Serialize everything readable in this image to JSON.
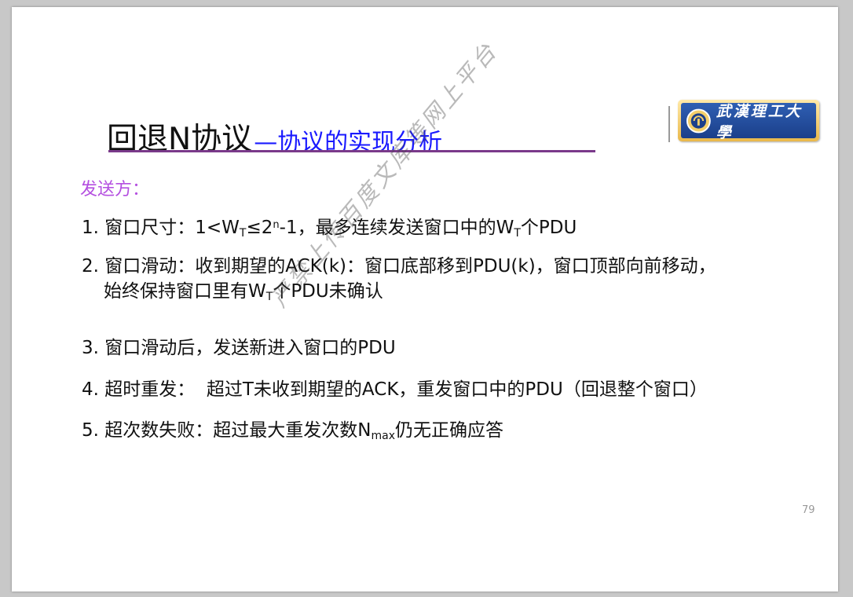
{
  "slide": {
    "title_main": "回退N协议",
    "title_sub": "—协议的实现分析",
    "logo_text": "武漢理工大學",
    "section_label": "发送方：",
    "items": [
      {
        "num": "1.",
        "pre": " 窗口尺寸：1<W",
        "sub1": "T",
        "mid1": "≤2",
        "sup1": "n",
        "mid2": "-1，最多连续发送窗口中的W",
        "sub2": "T",
        "post": "个PDU"
      },
      {
        "num": "2.",
        "line1": " 窗口滑动：收到期望的ACK(k)：窗口底部移到PDU(k)，窗口顶部向前移动，",
        "line2_pre": "始终保持窗口里有W",
        "line2_sub": "T",
        "line2_post": "个PDU未确认"
      },
      {
        "num": "3.",
        "text": " 窗口滑动后，发送新进入窗口的PDU"
      },
      {
        "num": "4.",
        "text": " 超时重发：  超过T未收到期望的ACK，重发窗口中的PDU（回退整个窗口）"
      },
      {
        "num": "5.",
        "pre": " 超次数失败：超过最大重发次数N",
        "sub": "max",
        "post": "仍无正确应答"
      }
    ],
    "watermark": "严禁上传百度文库等网上平台",
    "page_number": "79"
  }
}
